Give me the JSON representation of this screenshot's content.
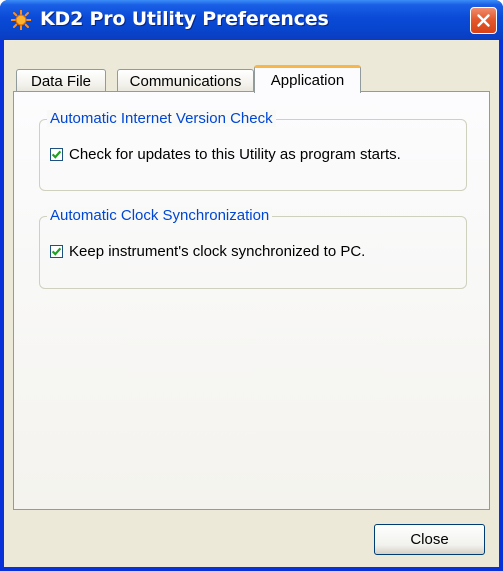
{
  "window": {
    "title": "KD2 Pro Utility Preferences",
    "accent_color": "#0a4ad6",
    "close_icon": "close-x"
  },
  "tabs": [
    {
      "label": "Data File",
      "active": false
    },
    {
      "label": "Communications",
      "active": false
    },
    {
      "label": "Application",
      "active": true
    }
  ],
  "groups": {
    "version_check": {
      "legend": "Automatic Internet Version Check",
      "checkbox_label": "Check for updates to this Utility as program starts.",
      "checked": true
    },
    "clock_sync": {
      "legend": "Automatic Clock Synchronization",
      "checkbox_label": "Keep instrument's clock synchronized to PC.",
      "checked": true
    }
  },
  "buttons": {
    "close_label": "Close"
  },
  "colors": {
    "legend_text": "#0046d5",
    "check_mark": "#21a121"
  }
}
